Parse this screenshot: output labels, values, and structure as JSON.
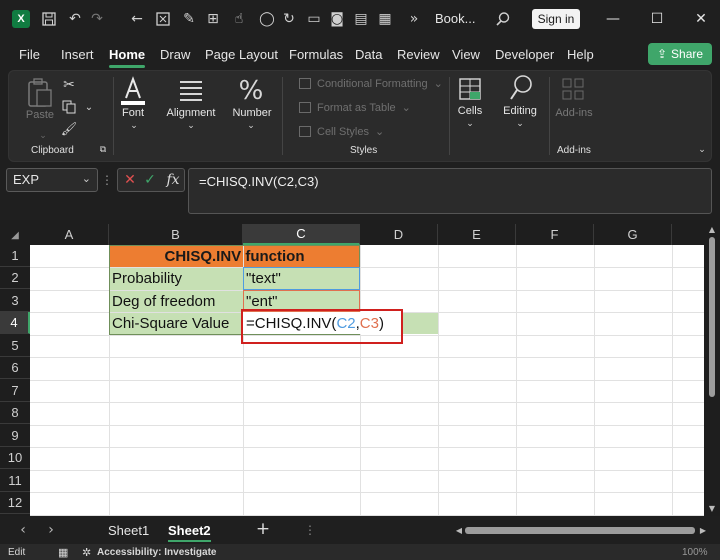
{
  "titlebar": {
    "app_logo": "X",
    "doc_title": "Book...",
    "signin_label": "Sign in",
    "icons": [
      "save-icon",
      "undo-icon",
      "redo-icon",
      "back-icon",
      "format-painter-icon",
      "brush-icon",
      "touch-icon",
      "circle-icon",
      "refresh-icon",
      "file-icon",
      "camera-icon",
      "doc-icon",
      "more-icon",
      "search-icon"
    ],
    "minimize": "—",
    "restore": "☐",
    "close": "✕"
  },
  "menu": {
    "tabs": [
      "File",
      "Insert",
      "Home",
      "Draw",
      "Page Layout",
      "Formulas",
      "Data",
      "Review",
      "View",
      "Developer",
      "Help"
    ],
    "active": "Home",
    "share_label": "Share"
  },
  "ribbon": {
    "clipboard": {
      "paste_label": "Paste",
      "group_label": "Clipboard"
    },
    "font_label": "Font",
    "alignment_label": "Alignment",
    "number_label": "Number",
    "styles": {
      "conditional": "Conditional Formatting",
      "format_table": "Format as Table",
      "cell_styles": "Cell Styles",
      "group_label": "Styles"
    },
    "cells_label": "Cells",
    "editing_label": "Editing",
    "addins": {
      "button_label": "Add-ins",
      "group_label": "Add-ins"
    }
  },
  "formula_bar": {
    "name_box": "EXP",
    "fx": "fx",
    "formula": "=CHISQ.INV(C2,C3)"
  },
  "grid": {
    "columns": [
      "A",
      "B",
      "C",
      "D",
      "E",
      "F",
      "G"
    ],
    "rows": [
      "1",
      "2",
      "3",
      "4",
      "5",
      "6",
      "7",
      "8",
      "9",
      "10",
      "11",
      "12"
    ],
    "cells": {
      "b1": "CHISQ.INV function",
      "b2": "Probability",
      "c2": "\"text\"",
      "b3": "Deg of freedom",
      "c3": "\"ent\"",
      "b4": "Chi-Square Value",
      "c4_fn": "=CHISQ.INV(",
      "c4_ref1": "C2",
      "c4_comma": ",",
      "c4_ref2": "C3",
      "c4_close": ")"
    }
  },
  "sheets": {
    "tabs": [
      "Sheet1",
      "Sheet2"
    ],
    "active": "Sheet2",
    "add": "+"
  },
  "status": {
    "mode": "Edit",
    "accessibility": "Accessibility: Investigate",
    "zoom": "100%"
  },
  "colors": {
    "header_orange": "#ed7d31",
    "cell_green": "#c6e0b4",
    "highlight_red": "#d0201e",
    "accent_green": "#3fa66a",
    "ref_blue": "#4f9be0",
    "ref_orange": "#e0704f"
  }
}
